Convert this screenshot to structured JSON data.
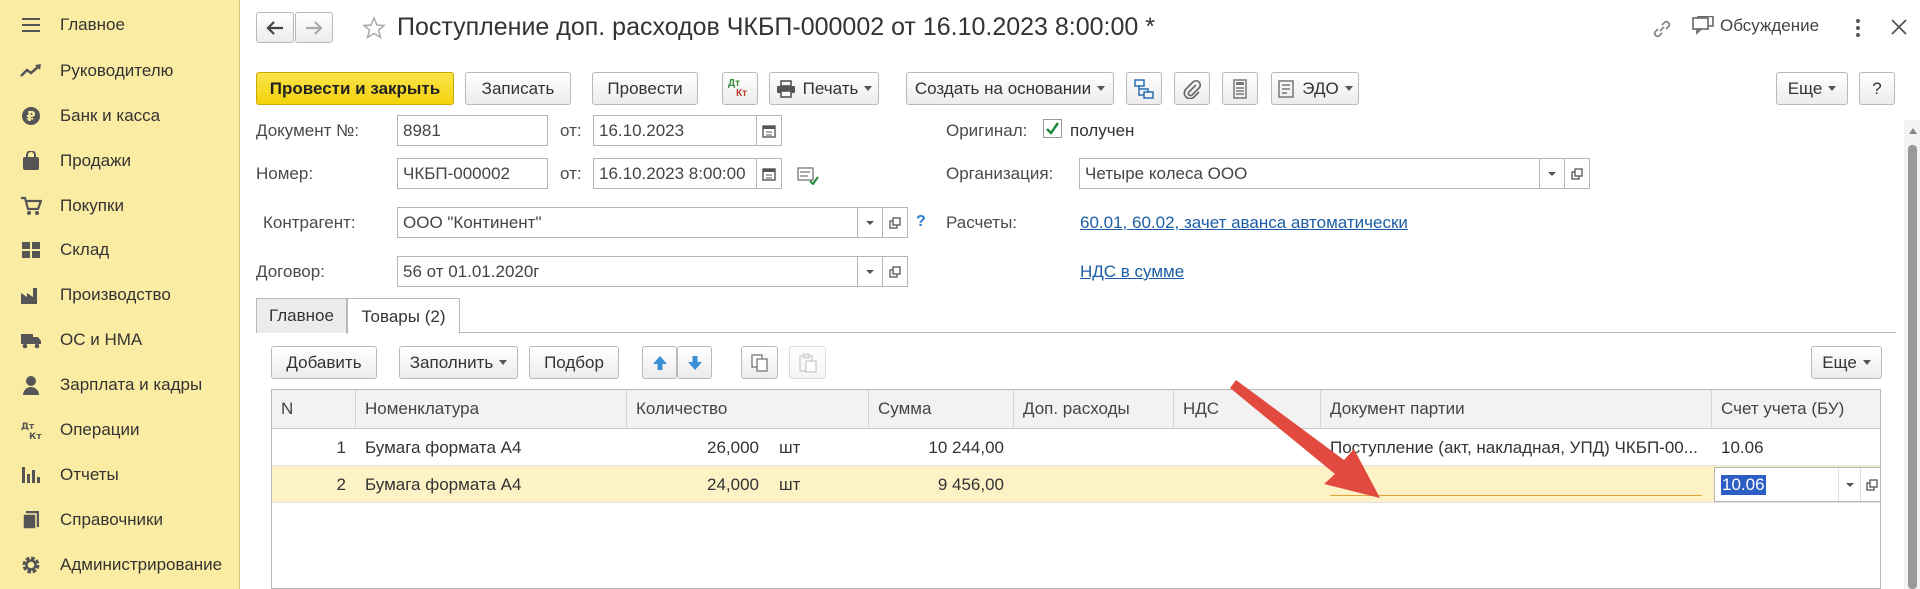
{
  "sidebar": {
    "items": [
      {
        "label": "Главное",
        "icon": "menu-icon"
      },
      {
        "label": "Руководителю",
        "icon": "trend-icon"
      },
      {
        "label": "Банк и касса",
        "icon": "ruble-coin-icon"
      },
      {
        "label": "Продажи",
        "icon": "shopping-bag-icon"
      },
      {
        "label": "Покупки",
        "icon": "cart-icon"
      },
      {
        "label": "Склад",
        "icon": "warehouse-grid-icon"
      },
      {
        "label": "Производство",
        "icon": "factory-icon"
      },
      {
        "label": "ОС и НМА",
        "icon": "truck-icon"
      },
      {
        "label": "Зарплата и кадры",
        "icon": "person-icon"
      },
      {
        "label": "Операции",
        "icon": "dt-kt-icon"
      },
      {
        "label": "Отчеты",
        "icon": "bar-chart-icon"
      },
      {
        "label": "Справочники",
        "icon": "book-icon"
      },
      {
        "label": "Администрирование",
        "icon": "gear-icon"
      }
    ]
  },
  "header": {
    "title": "Поступление доп. расходов ЧКБП-000002 от 16.10.2023 8:00:00 *",
    "discussion_label": "Обсуждение"
  },
  "toolbar": {
    "post_close_label": "Провести и закрыть",
    "save_label": "Записать",
    "post_label": "Провести",
    "dt_kt_top": "Дт",
    "dt_kt_bottom": "Кт",
    "print_label": "Печать",
    "create_basis_label": "Создать на основании",
    "edo_label": "ЭДО",
    "more_label": "Еще",
    "help_label": "?"
  },
  "form": {
    "doc_no_label": "Документ №:",
    "doc_no_value": "8981",
    "from_label": "от:",
    "doc_date_value": "16.10.2023",
    "number_label": "Номер:",
    "number_value": "ЧКБП-000002",
    "number_date_value": "16.10.2023  8:00:00",
    "original_label": "Оригинал:",
    "original_checked_label": "получен",
    "org_label": "Организация:",
    "org_value": "Четыре колеса ООО",
    "counterparty_label": "Контрагент:",
    "counterparty_value": "ООО \"Континент\"",
    "counterparty_help": "?",
    "settlements_label": "Расчеты:",
    "settlements_link": "60.01, 60.02, зачет аванса автоматически",
    "contract_label": "Договор:",
    "contract_value": "56 от 01.01.2020г",
    "vat_link": "НДС в сумме"
  },
  "tabs": [
    {
      "label": "Главное",
      "active": false
    },
    {
      "label": "Товары (2)",
      "active": true
    }
  ],
  "table_toolbar": {
    "add_label": "Добавить",
    "fill_label": "Заполнить",
    "select_label": "Подбор",
    "more_label": "Еще"
  },
  "table": {
    "columns": [
      "N",
      "Номенклатура",
      "Количество",
      "Сумма",
      "Доп. расходы",
      "НДС",
      "Документ партии",
      "Счет учета (БУ)"
    ],
    "rows": [
      {
        "n": "1",
        "item": "Бумага формата А4",
        "qty": "26,000",
        "unit": "шт",
        "sum": "10 244,00",
        "extra": "",
        "vat": "",
        "batch_doc": "Поступление (акт, накладная, УПД) ЧКБП-00...",
        "account": "10.06"
      },
      {
        "n": "2",
        "item": "Бумага формата А4",
        "qty": "24,000",
        "unit": "шт",
        "sum": "9 456,00",
        "extra": "",
        "vat": "",
        "batch_doc": "",
        "account": "10.06"
      }
    ]
  },
  "colors": {
    "sidebar_bg": "#fbeca3",
    "primary_button": "#f4d20c",
    "selected_row": "#fdf2c6",
    "link": "#1c5ea6",
    "arrow": "#e34a3f"
  }
}
